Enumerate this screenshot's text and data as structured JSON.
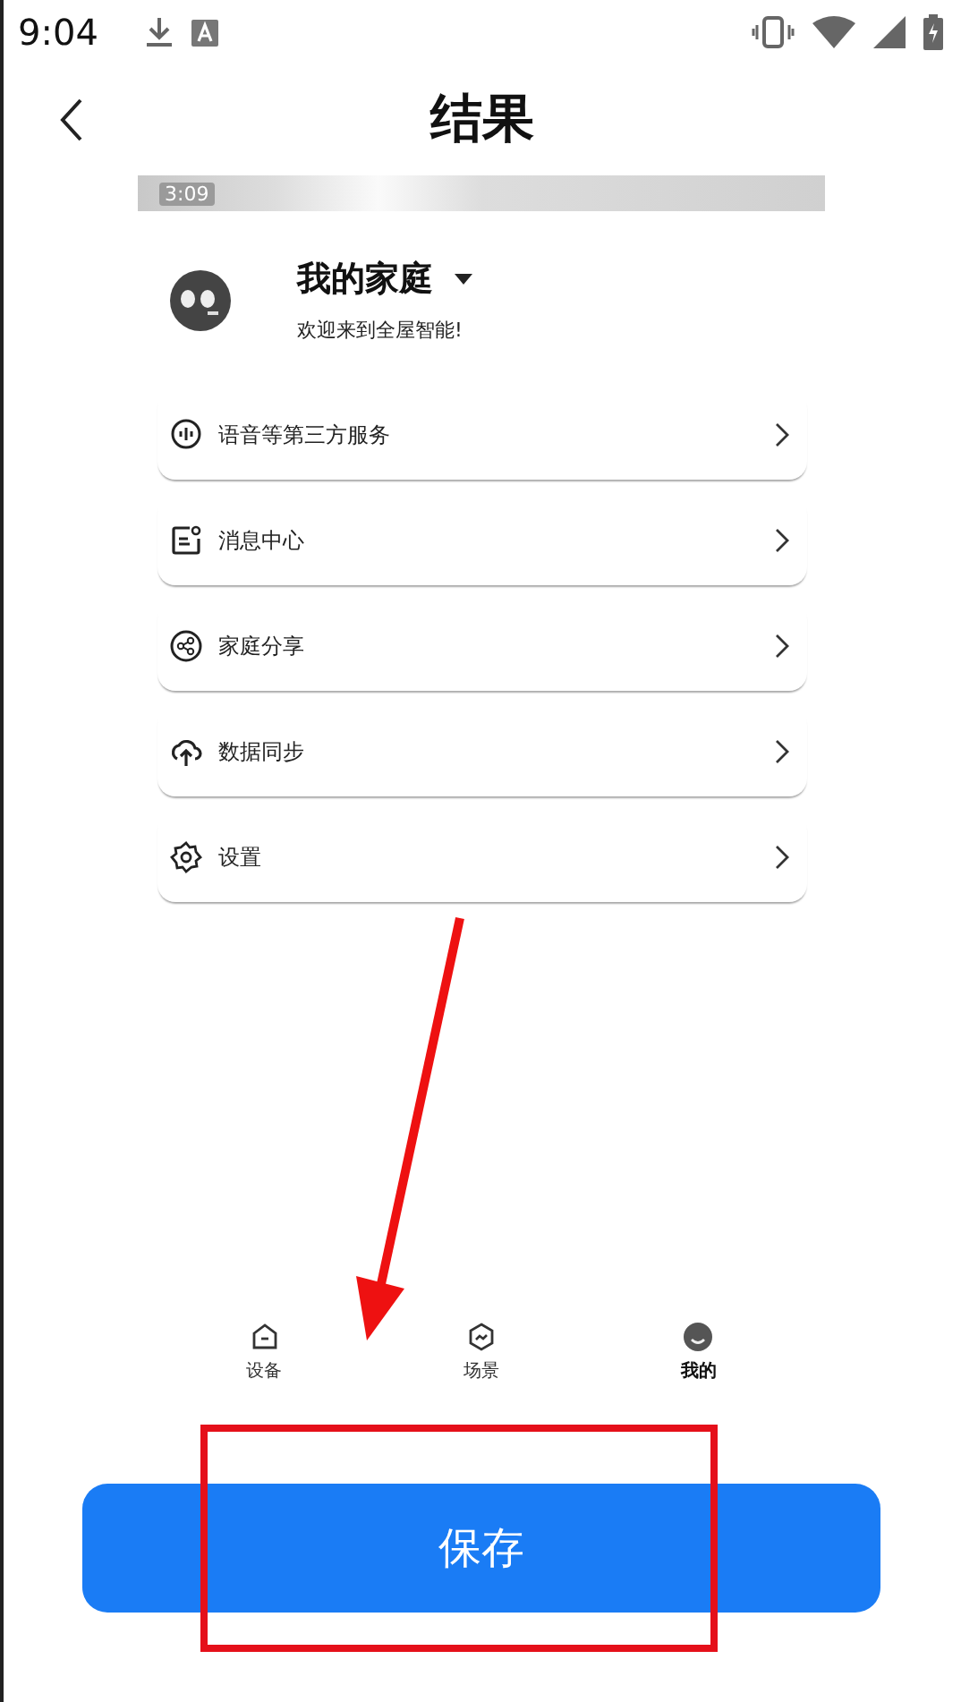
{
  "status_bar": {
    "time": "9:04"
  },
  "header": {
    "title": "结果"
  },
  "screenshot": {
    "status_bar": {
      "time": "3:09"
    },
    "profile": {
      "name": "我的家庭",
      "greeting": "欢迎来到全屋智能!"
    },
    "menu": [
      {
        "label": "语音等第三方服务"
      },
      {
        "label": "消息中心"
      },
      {
        "label": "家庭分享"
      },
      {
        "label": "数据同步"
      },
      {
        "label": "设置"
      }
    ],
    "tabs": [
      {
        "label": "设备",
        "selected": false
      },
      {
        "label": "场景",
        "selected": false
      },
      {
        "label": "我的",
        "selected": true
      }
    ]
  },
  "save_button": {
    "label": "保存"
  }
}
